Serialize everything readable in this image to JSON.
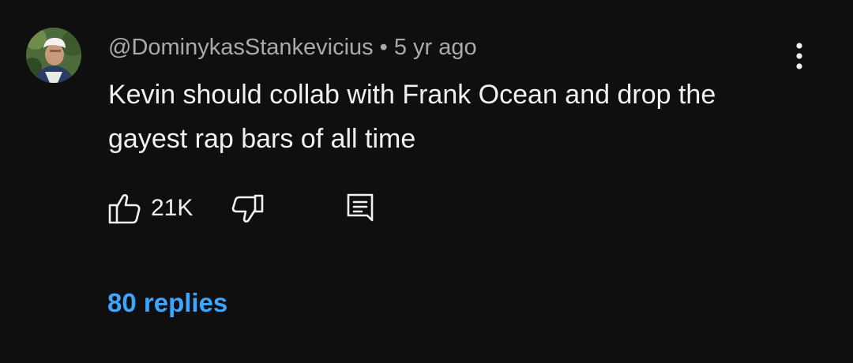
{
  "comment": {
    "author": "@DominykasStankevicius",
    "separator": "•",
    "age": "5 yr ago",
    "text": "Kevin should collab with Frank Ocean and drop the gayest rap bars of all time",
    "like_count": "21K",
    "replies_label": "80 replies"
  },
  "icons": {
    "avatar": "user-avatar-photo",
    "like": "thumbs-up-icon",
    "dislike": "thumbs-down-icon",
    "reply": "comment-reply-icon",
    "menu": "more-vert-icon"
  },
  "colors": {
    "background": "#0f0f0f",
    "text": "#f1f1f1",
    "muted": "#aaaaaa",
    "link": "#3ea6ff"
  }
}
